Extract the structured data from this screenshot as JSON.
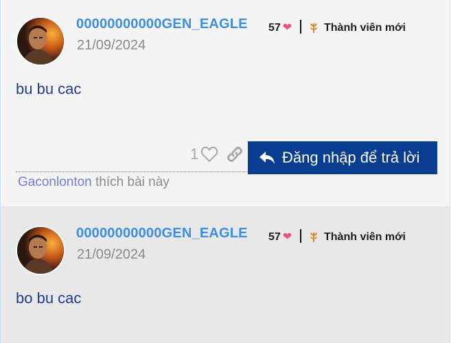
{
  "posts": [
    {
      "username": "00000000000GEN_EAGLE",
      "like_total": "57",
      "rank": "Thành viên mới",
      "date": "21/09/2024",
      "content": "bu bu cac",
      "like_count": "1",
      "reply_label": "Đăng nhập để trả lời",
      "liker": "Gaconlonton",
      "liked_text": "thích bài này"
    },
    {
      "username": "00000000000GEN_EAGLE",
      "like_total": "57",
      "rank": "Thành viên mới",
      "date": "21/09/2024",
      "content": "bo bu cac"
    }
  ],
  "colors": {
    "username": "#3d8ee0",
    "content": "#1f3c8c",
    "reply_button": "#083d91",
    "heart": "#ee4d86",
    "rank_icon": "#d98a2b",
    "post_bg_1": "#f5f4f4",
    "post_bg_2": "#e8e8e8"
  },
  "icons": [
    "heart-icon",
    "rank-sprout-icon",
    "like-heart-outline-icon",
    "link-icon",
    "reply-arrow-icon"
  ]
}
